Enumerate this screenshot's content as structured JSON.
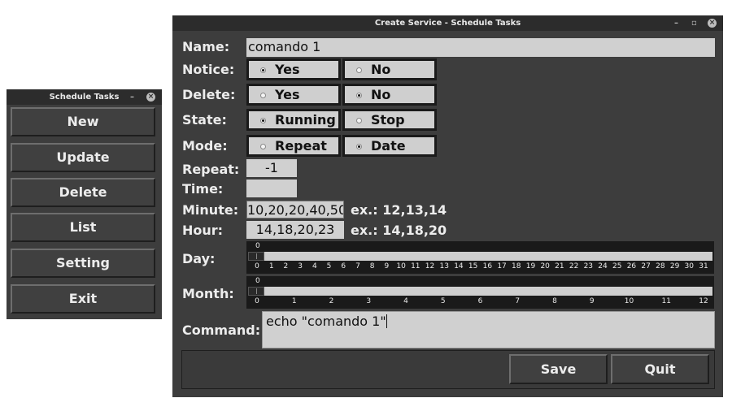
{
  "left_window": {
    "title": "Schedule Tasks",
    "minimize": "–",
    "close": "×",
    "buttons": [
      "New",
      "Update",
      "Delete",
      "List",
      "Setting",
      "Exit"
    ]
  },
  "main_window": {
    "title": "Create Service - Schedule Tasks",
    "minimize": "–",
    "maximize": "▫",
    "close": "×",
    "labels": {
      "name": "Name:",
      "notice": "Notice:",
      "delete": "Delete:",
      "state": "State:",
      "mode": "Mode:",
      "repeat": "Repeat:",
      "time": "Time:",
      "minute": "Minute:",
      "hour": "Hour:",
      "day": "Day:",
      "month": "Month:",
      "command": "Command:"
    },
    "name_value": "comando 1",
    "notice": {
      "options": [
        "Yes",
        "No"
      ],
      "selected": "Yes"
    },
    "delete": {
      "options": [
        "Yes",
        "No"
      ],
      "selected": "No"
    },
    "state": {
      "options": [
        "Running",
        "Stop"
      ],
      "selected": "Running"
    },
    "mode": {
      "options": [
        "Repeat",
        "Date"
      ],
      "selected": "Date"
    },
    "repeat_value": "-1",
    "time_value": "",
    "minute_value": "10,20,20,40,50",
    "minute_example": "ex.: 12,13,14",
    "hour_value": "14,18,20,23",
    "hour_example": "ex.: 14,18,20",
    "day_scale": {
      "value": "0",
      "ticks": [
        "0",
        "1",
        "2",
        "3",
        "4",
        "5",
        "6",
        "7",
        "8",
        "9",
        "10",
        "11",
        "12",
        "13",
        "14",
        "15",
        "16",
        "17",
        "18",
        "19",
        "20",
        "21",
        "22",
        "23",
        "24",
        "25",
        "26",
        "27",
        "28",
        "29",
        "30",
        "31"
      ]
    },
    "month_scale": {
      "value": "0",
      "ticks": [
        "0",
        "1",
        "2",
        "3",
        "4",
        "5",
        "6",
        "7",
        "8",
        "9",
        "10",
        "11",
        "12"
      ]
    },
    "command_value": "echo \"comando 1\"",
    "save_label": "Save",
    "quit_label": "Quit"
  }
}
